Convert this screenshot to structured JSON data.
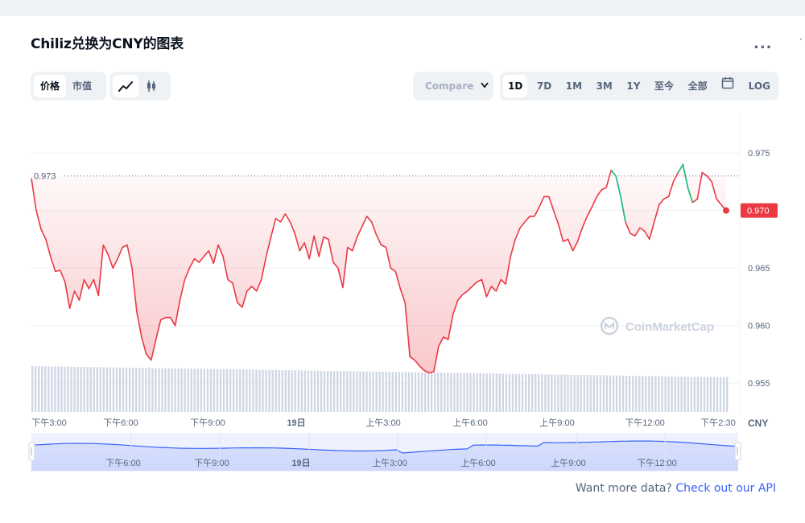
{
  "title": "Chiliz兑换为CNY的图表",
  "more_label": "...",
  "toggles": {
    "type_buttons": [
      "价格",
      "市值"
    ],
    "chart_style_icons": [
      "line-chart-icon",
      "candlestick-icon"
    ]
  },
  "compare_label": "Compare",
  "range_buttons": [
    "1D",
    "7D",
    "1M",
    "3M",
    "1Y",
    "至今",
    "全部"
  ],
  "calendar_icon": "calendar-icon",
  "log_label": "LOG",
  "currency_label": "CNY",
  "watermark": "CoinMarketCap",
  "footer": {
    "text": "Want more data? ",
    "link": "Check out our API"
  },
  "colors": {
    "down": "#ea3943",
    "up": "#16c784",
    "accent": "#3861fb",
    "muted": "#58667e"
  },
  "chart_data": {
    "type": "area",
    "y_ticks": [
      "0.975",
      "0.970",
      "0.965",
      "0.960",
      "0.955"
    ],
    "ylim": [
      0.9525,
      0.9785
    ],
    "x_ticks": [
      "下午3:00",
      "下午6:00",
      "下午9:00",
      "19日",
      "上午3:00",
      "上午6:00",
      "上午9:00",
      "下午12:00",
      "下午2:30"
    ],
    "open_price_label": "0.973",
    "open_price": 0.973,
    "current_price_label": "0.970",
    "current_price": 0.97,
    "navigator_ticks": [
      "下午6:00",
      "下午9:00",
      "19日",
      "上午3:00",
      "上午6:00",
      "上午9:00",
      "下午12:00"
    ],
    "prices": [
      0.9728,
      0.97,
      0.9684,
      0.9675,
      0.966,
      0.9647,
      0.9648,
      0.9638,
      0.9615,
      0.963,
      0.9622,
      0.964,
      0.9632,
      0.964,
      0.9626,
      0.967,
      0.9662,
      0.965,
      0.9658,
      0.9668,
      0.967,
      0.965,
      0.9612,
      0.959,
      0.9575,
      0.957,
      0.9588,
      0.9605,
      0.9607,
      0.9607,
      0.96,
      0.9622,
      0.964,
      0.965,
      0.9658,
      0.9655,
      0.966,
      0.9665,
      0.9654,
      0.967,
      0.966,
      0.964,
      0.9637,
      0.962,
      0.9616,
      0.963,
      0.9634,
      0.963,
      0.964,
      0.966,
      0.9677,
      0.9693,
      0.969,
      0.9697,
      0.969,
      0.968,
      0.9665,
      0.9672,
      0.9658,
      0.9678,
      0.966,
      0.9677,
      0.9675,
      0.9655,
      0.965,
      0.9633,
      0.9668,
      0.9665,
      0.9677,
      0.9686,
      0.9695,
      0.969,
      0.9679,
      0.967,
      0.9668,
      0.965,
      0.9647,
      0.9632,
      0.962,
      0.9573,
      0.957,
      0.9565,
      0.9561,
      0.9559,
      0.956,
      0.9582,
      0.959,
      0.9588,
      0.961,
      0.9622,
      0.9627,
      0.963,
      0.9634,
      0.9638,
      0.964,
      0.9625,
      0.9634,
      0.963,
      0.964,
      0.9636,
      0.966,
      0.9675,
      0.9685,
      0.969,
      0.9695,
      0.9695,
      0.9703,
      0.9712,
      0.9712,
      0.97,
      0.9688,
      0.9673,
      0.9675,
      0.9665,
      0.9673,
      0.9685,
      0.9695,
      0.9703,
      0.9712,
      0.9718,
      0.972,
      0.9735,
      0.973,
      0.9712,
      0.969,
      0.968,
      0.9678,
      0.9685,
      0.9682,
      0.9675,
      0.969,
      0.9705,
      0.971,
      0.9712,
      0.9725,
      0.9733,
      0.974,
      0.972,
      0.9707,
      0.971,
      0.9733,
      0.973,
      0.9725,
      0.971,
      0.9705,
      0.97
    ],
    "up_segments": [
      [
        122,
        123
      ],
      [
        136,
        137
      ]
    ]
  }
}
